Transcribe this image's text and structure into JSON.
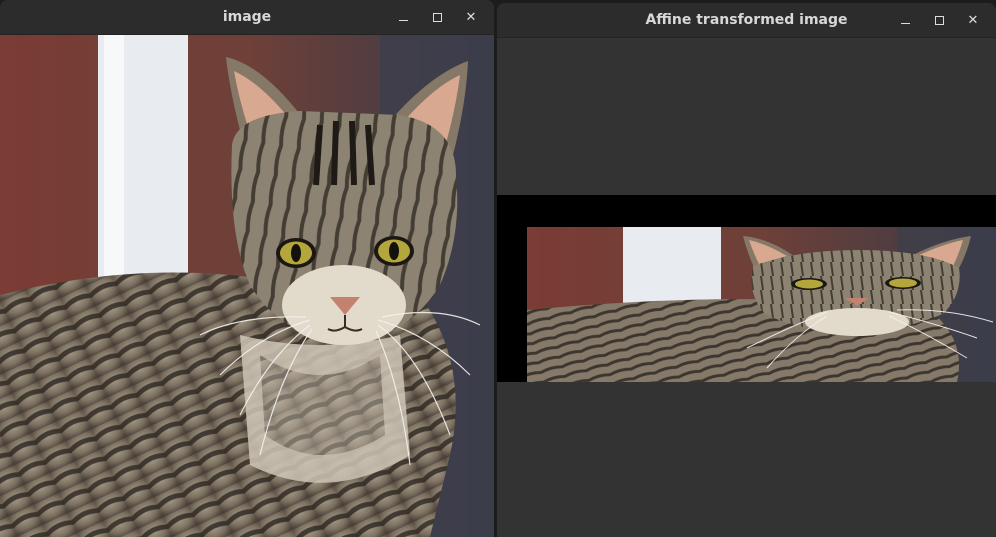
{
  "windows": [
    {
      "title": "image",
      "controls": {
        "minimize": "minimize-icon",
        "maximize": "maximize-icon",
        "close": "✕"
      },
      "image": {
        "subject": "tabby-cat",
        "colors": {
          "fur": "#8a7e6e",
          "stripes": "#2a241e",
          "eyes": "#b8a838",
          "nose": "#c48a78",
          "background": "#7a3a30"
        }
      }
    },
    {
      "title": "Affine transformed image",
      "controls": {
        "minimize": "minimize-icon",
        "maximize": "maximize-icon",
        "close": "✕"
      },
      "canvas_color": "#333333",
      "image": {
        "subject": "tabby-cat",
        "transform": "affine",
        "border_color": "#000000"
      }
    }
  ],
  "colors": {
    "titlebar": "#2c2c2c",
    "title_text": "#d8d8d8",
    "window_bg": "#303030"
  }
}
